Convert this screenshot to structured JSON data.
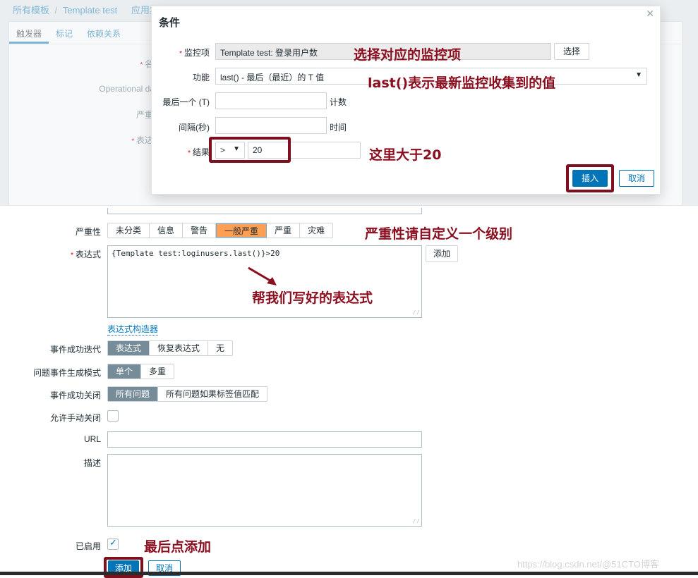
{
  "background_page": {
    "breadcrumb": [
      "所有模板",
      "Template test",
      "应用集"
    ],
    "tabs": [
      {
        "label": "触发器",
        "active": true
      },
      {
        "label": "标记",
        "active": false
      },
      {
        "label": "依赖关系",
        "active": false
      }
    ],
    "labels": {
      "name": "名称",
      "operational_data": "Operational data",
      "severity": "严重性",
      "expression": "表达式"
    }
  },
  "modal": {
    "title": "条件",
    "close_icon": "close-icon",
    "fields": {
      "item": {
        "label": "监控项",
        "value": "Template test: 登录用户数",
        "button": "选择"
      },
      "function": {
        "label": "功能",
        "value": "last() - 最后（最近）的 T 值"
      },
      "last_t": {
        "label": "最后一个 (T)",
        "value": "",
        "suffix": "计数"
      },
      "interval": {
        "label": "间隔(秒)",
        "value": "",
        "suffix": "时间"
      },
      "result": {
        "label": "结果",
        "operator": ">",
        "value": "20"
      }
    },
    "buttons": {
      "insert": "插入",
      "cancel": "取消"
    }
  },
  "form": {
    "severity": {
      "label": "严重性",
      "options": [
        "未分类",
        "信息",
        "警告",
        "一般严重",
        "严重",
        "灾难"
      ],
      "selected": "一般严重"
    },
    "expression": {
      "label": "表达式",
      "value": "{Template test:loginusers.last()}>20",
      "add_button": "添加",
      "builder_link": "表达式构造器"
    },
    "ok_event_generation": {
      "label": "事件成功迭代",
      "options": [
        "表达式",
        "恢复表达式",
        "无"
      ],
      "selected": "表达式"
    },
    "problem_event_mode": {
      "label": "问题事件生成模式",
      "options": [
        "单个",
        "多重"
      ],
      "selected": "单个"
    },
    "ok_event_closes": {
      "label": "事件成功关闭",
      "options": [
        "所有问题",
        "所有问题如果标签值匹配"
      ],
      "selected": "所有问题"
    },
    "manual_close": {
      "label": "允许手动关闭",
      "checked": false
    },
    "url": {
      "label": "URL",
      "value": ""
    },
    "description": {
      "label": "描述",
      "value": ""
    },
    "enabled": {
      "label": "已启用",
      "checked": true
    },
    "buttons": {
      "add": "添加",
      "cancel": "取消"
    }
  },
  "annotations": {
    "select_item": "选择对应的监控项",
    "last_meaning": "last()表示最新监控收集到的值",
    "greater_than": "这里大于20",
    "severity_hint": "严重性请自定义一个级别",
    "expression_hint": "帮我们写好的表达式",
    "final_hint": "最后点添加"
  },
  "watermark": "https://blog.csdn.net/@51CTO博客",
  "colors": {
    "accent": "#0275b8",
    "annotation": "#8b0e1f",
    "severity_selected": "#ff9f53",
    "segment_selected": "#768d99"
  }
}
